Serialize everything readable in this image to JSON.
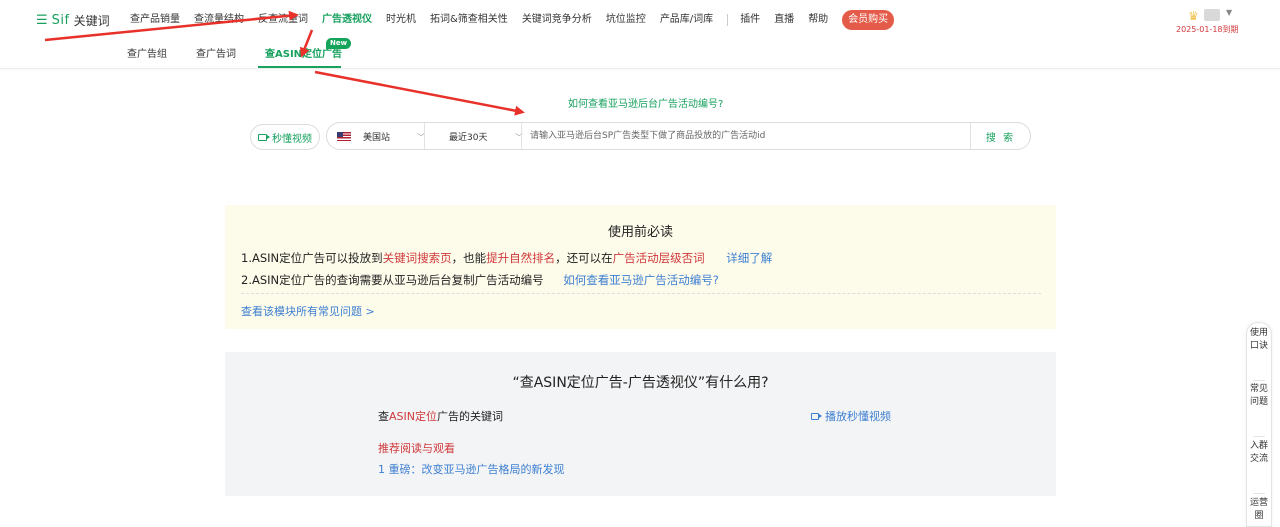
{
  "topnav": {
    "brand": "Sif",
    "brand_suffix": "关键词",
    "items": [
      {
        "label": "查产品销量"
      },
      {
        "label": "查流量结构"
      },
      {
        "label": "反查流量词"
      },
      {
        "label": "广告透视仪"
      },
      {
        "label": "时光机"
      },
      {
        "label": "拓词&筛查相关性"
      },
      {
        "label": "关键词竞争分析"
      },
      {
        "label": "坑位监控"
      },
      {
        "label": "产品库/词库"
      },
      {
        "label": "插件"
      },
      {
        "label": "直播"
      },
      {
        "label": "帮助"
      }
    ],
    "active_index": 3,
    "member_button": "会员购买",
    "expire_text": "2025-01-18到期"
  },
  "subtabs": {
    "items": [
      {
        "label": "查广告组"
      },
      {
        "label": "查广告词"
      },
      {
        "label": "查ASIN定位广告"
      }
    ],
    "new_badge": "New"
  },
  "search": {
    "help_link": "如何查看亚马逊后台广告活动编号?",
    "video_button": "秒懂视频",
    "site": "美国站",
    "range": "最近30天",
    "placeholder": "请输入亚马逊后台SP广告类型下做了商品投放的广告活动id",
    "button": "搜 索"
  },
  "notice": {
    "title": "使用前必读",
    "line1": {
      "a": "1.ASIN定位广告可以投放到",
      "b": "关键词搜索页",
      "c": "，也能",
      "d": "提升自然排名",
      "e": "，还可以在",
      "f": "广告活动层级否词",
      "link": "详细了解"
    },
    "line2": {
      "a": "2.ASIN定位广告的查询需要从亚马逊后台复制广告活动编号",
      "link": "如何查看亚马逊广告活动编号?"
    },
    "faq_link": "查看该模块所有常见问题 >"
  },
  "usage": {
    "title": "“查ASIN定位广告-广告透视仪”有什么用?",
    "kw_prefix": "查",
    "kw_red": "ASIN定位",
    "kw_suffix": "广告的关键词",
    "video_link": "播放秒懂视频",
    "recommend": "推荐阅读与观看",
    "article": "1 重磅：改变亚马逊广告格局的新发现"
  },
  "side_tool": {
    "items": [
      "使用口诀",
      "常见问题",
      "入群交流",
      "运营圈"
    ]
  },
  "colors": {
    "brand_green": "#19a15f",
    "accent_red": "#d0383b",
    "link_blue": "#3d7fd1",
    "member_red": "#e45b4a",
    "annotation_red": "#e8312a"
  }
}
